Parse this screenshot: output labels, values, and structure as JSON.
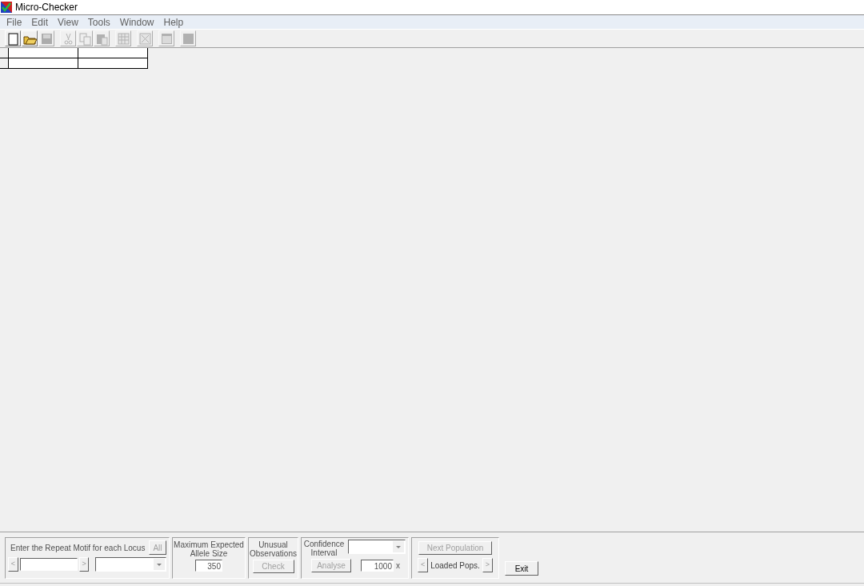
{
  "window": {
    "title": "Micro-Checker"
  },
  "menu": [
    "File",
    "Edit",
    "View",
    "Tools",
    "Window",
    "Help"
  ],
  "toolbar": [
    {
      "kind": "new",
      "disabled": false
    },
    {
      "kind": "open",
      "disabled": false
    },
    {
      "kind": "save",
      "disabled": true
    },
    {
      "kind": "cut",
      "disabled": true
    },
    {
      "kind": "copy",
      "disabled": true
    },
    {
      "kind": "paste",
      "disabled": true
    },
    {
      "kind": "grid",
      "disabled": true
    },
    {
      "kind": "clear",
      "disabled": true
    },
    {
      "kind": "window",
      "disabled": true
    },
    {
      "kind": "block",
      "disabled": true
    }
  ],
  "panels": {
    "repeat_motif": {
      "label": "Enter the Repeat Motif for each Locus",
      "all_button": {
        "label": "All",
        "disabled": true
      },
      "prev": {
        "label": "<",
        "disabled": true
      },
      "next": {
        "label": ">",
        "disabled": true
      }
    },
    "max_allele": {
      "label": "Maximum Expected Allele Size",
      "value": "350"
    },
    "unusual": {
      "label": "Unusual Observations",
      "button": {
        "label": "Check",
        "disabled": true
      }
    },
    "confidence": {
      "label": "Confidence Interval",
      "button": {
        "label": "Analyse",
        "disabled": true
      },
      "value": "1000",
      "unit": "x"
    },
    "populations": {
      "next_button": {
        "label": "Next Population",
        "disabled": true
      },
      "prev": {
        "label": "<",
        "disabled": true
      },
      "label": "Loaded Pops.",
      "next": {
        "label": ">",
        "disabled": true
      }
    },
    "exit_button": {
      "label": "Exit",
      "disabled": false
    }
  }
}
